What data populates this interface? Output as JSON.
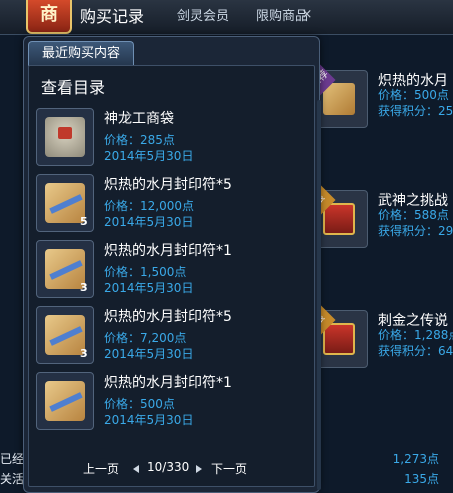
{
  "topbar": {
    "shop_badge": "商",
    "tabs": [
      {
        "label": "购买记录"
      },
      {
        "label": "剑灵会员"
      },
      {
        "label": "限购商品"
      }
    ],
    "close_glyph": "×"
  },
  "background_items": [
    {
      "name": "炽热的水月",
      "ribbon": "推荐",
      "price": "价格：500点",
      "points": "获得积分：25",
      "icon": "scroll-icon"
    },
    {
      "name": "武神之挑战",
      "ribbon": "限",
      "price": "价格：588点",
      "points": "获得积分：29",
      "icon": "gift-box-icon"
    },
    {
      "name": "刺金之传说",
      "ribbon": "限",
      "price": "价格：1,288点",
      "points": "获得积分：64",
      "icon": "gift-box-icon"
    }
  ],
  "bottom_left": {
    "line1": "已经",
    "line2": "关活"
  },
  "bottom_right": {
    "line1": "1,273点",
    "line2": "135点"
  },
  "panel": {
    "tab_label": "最近购买内容",
    "title": "查看目录",
    "entries": [
      {
        "name": "神龙工商袋",
        "qty": "",
        "price": "价格：285点",
        "date": "2014年5月30日",
        "icon": "bag-icon"
      },
      {
        "name": "炽热的水月封印符*5",
        "qty": "5",
        "price": "价格：12,000点",
        "date": "2014年5月30日",
        "icon": "talisman-icon"
      },
      {
        "name": "炽热的水月封印符*1",
        "qty": "3",
        "price": "价格：1,500点",
        "date": "2014年5月30日",
        "icon": "talisman-icon"
      },
      {
        "name": "炽热的水月封印符*5",
        "qty": "3",
        "price": "价格：7,200点",
        "date": "2014年5月30日",
        "icon": "talisman-icon"
      },
      {
        "name": "炽热的水月封印符*1",
        "qty": "",
        "price": "价格：500点",
        "date": "2014年5月30日",
        "icon": "talisman-icon"
      }
    ],
    "pager": {
      "prev_label": "上一页",
      "page_display": "10/330",
      "next_label": "下一页"
    }
  },
  "colors": {
    "accent_blue": "#3aa9e8",
    "panel_bg": "#1b2637",
    "badge_red": "#c0392b"
  }
}
